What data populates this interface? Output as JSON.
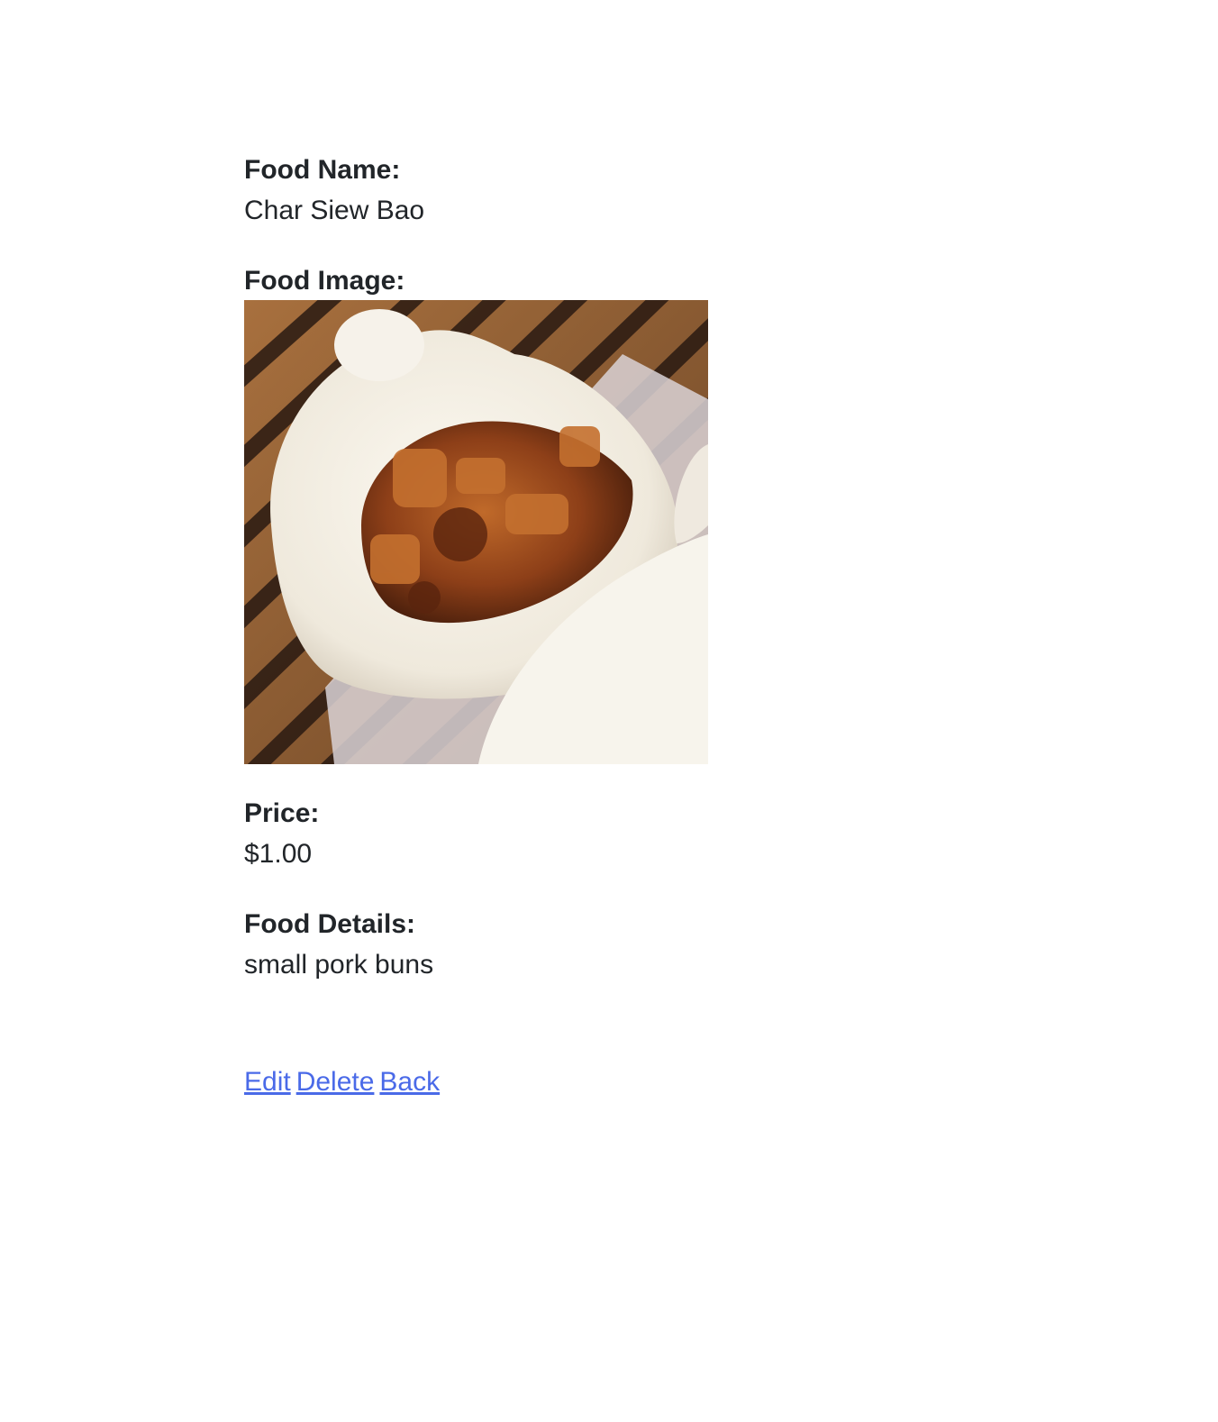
{
  "food": {
    "name_label": "Food Name:",
    "name": "Char Siew Bao",
    "image_label": "Food Image:",
    "image_icon": "steamed-bun-photo",
    "price_label": "Price:",
    "price": "$1.00",
    "details_label": "Food Details:",
    "details": "small pork buns"
  },
  "actions": {
    "edit": "Edit",
    "delete": "Delete",
    "back": "Back",
    "link_color": "#4a6ae8"
  }
}
